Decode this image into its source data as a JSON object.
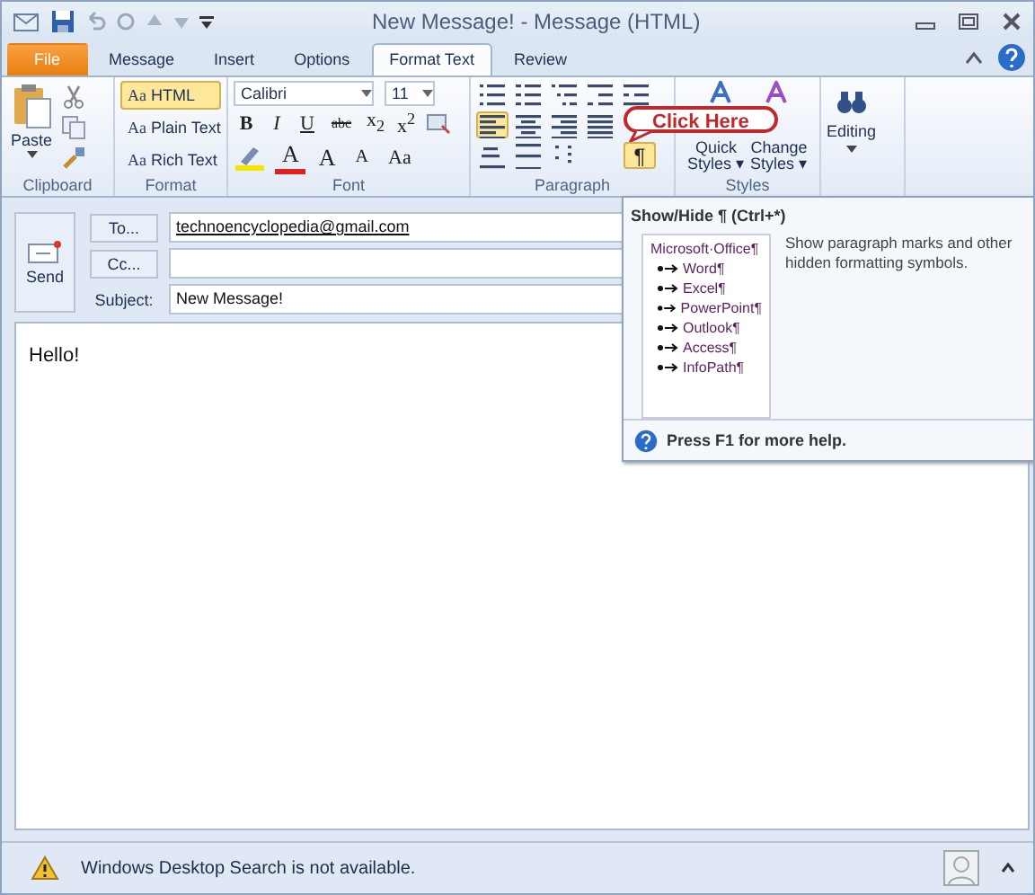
{
  "window": {
    "title": "New Message! - Message (HTML)"
  },
  "tabs": [
    {
      "label": "File",
      "kind": "file",
      "selected": false
    },
    {
      "label": "Message",
      "kind": "tab",
      "selected": false
    },
    {
      "label": "Insert",
      "kind": "tab",
      "selected": false
    },
    {
      "label": "Options",
      "kind": "tab",
      "selected": false
    },
    {
      "label": "Format Text",
      "kind": "tab",
      "selected": true
    },
    {
      "label": "Review",
      "kind": "tab",
      "selected": false
    }
  ],
  "clipboard": {
    "label": "Clipboard",
    "paste": "Paste"
  },
  "format": {
    "label": "Format",
    "options": [
      {
        "icon": "Aa",
        "label": "HTML",
        "selected": true
      },
      {
        "icon": "Aa",
        "label": "Plain Text",
        "selected": false
      },
      {
        "icon": "Aa",
        "label": "Rich Text",
        "selected": false
      }
    ]
  },
  "font": {
    "label": "Font",
    "family": "Calibri",
    "size": "11",
    "row1": [
      {
        "text": "B",
        "kind": "bold"
      },
      {
        "text": "I",
        "kind": "italic"
      },
      {
        "text": "U",
        "kind": "underline"
      },
      {
        "text": "abc",
        "kind": "strike"
      },
      {
        "text": "x$_{2}$",
        "kind": "plain"
      },
      {
        "text": "x$^{2}$",
        "kind": "plain"
      }
    ],
    "row2": [
      {
        "text": "A",
        "kind": "color"
      },
      {
        "text": "A",
        "kind": "grow"
      },
      {
        "text": "A",
        "kind": "shrink"
      },
      {
        "text": "Aa",
        "kind": "case"
      }
    ]
  },
  "paragraph": {
    "label": "Paragraph",
    "rows": [
      [
        {
          "kind": "bullets",
          "selected": false
        },
        {
          "kind": "numbering",
          "selected": false
        },
        {
          "kind": "multilevel",
          "selected": false
        },
        {
          "kind": "outdent",
          "selected": false
        },
        {
          "kind": "indent",
          "selected": false
        }
      ],
      [
        {
          "kind": "align-left",
          "selected": true
        },
        {
          "kind": "align-center",
          "selected": false
        },
        {
          "kind": "align-right",
          "selected": false
        },
        {
          "kind": "justify",
          "selected": false
        }
      ],
      [
        {
          "kind": "shading",
          "selected": false
        },
        {
          "kind": "borders",
          "selected": false
        },
        {
          "kind": "sort",
          "selected": false
        },
        {
          "kind": "show-hide",
          "label": "¶",
          "selected": true
        }
      ]
    ]
  },
  "styles": {
    "label": "Styles",
    "buttons": [
      {
        "line1": "Quick",
        "line2": "Styles ▾"
      },
      {
        "line1": "Change",
        "line2": "Styles ▾"
      }
    ]
  },
  "editing": {
    "label": "Editing"
  },
  "callout": {
    "text": "Click Here"
  },
  "compose": {
    "send": "Send",
    "to_button": "To...",
    "to_value": "technoencyclopedia@gmail.com",
    "cc_button": "Cc...",
    "subject_label": "Subject:",
    "subject_value": "New Message!",
    "body": "Hello!"
  },
  "tooltip": {
    "title": "Show/Hide ¶ (Ctrl+*)",
    "sample": {
      "text": "Microsoft·Office¶",
      "children": [
        {
          "text": "Word¶"
        },
        {
          "text": "Excel¶"
        },
        {
          "text": "PowerPoint¶"
        },
        {
          "text": "Outlook¶"
        },
        {
          "text": "Access¶"
        },
        {
          "text": "InfoPath¶"
        }
      ]
    },
    "description": "Show paragraph marks and other hidden formatting symbols.",
    "help": "Press F1 for more help."
  },
  "status_bar": {
    "message": "Windows Desktop Search is not available."
  }
}
